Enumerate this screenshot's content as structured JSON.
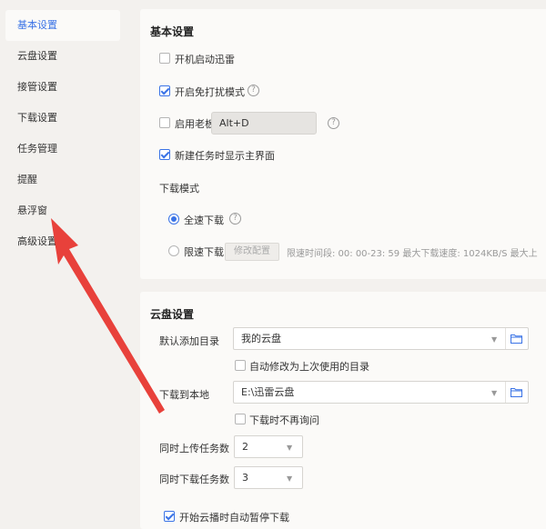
{
  "sidebar": {
    "items": [
      {
        "label": "基本设置"
      },
      {
        "label": "云盘设置"
      },
      {
        "label": "接管设置"
      },
      {
        "label": "下载设置"
      },
      {
        "label": "任务管理"
      },
      {
        "label": "提醒"
      },
      {
        "label": "悬浮窗"
      },
      {
        "label": "高级设置"
      }
    ]
  },
  "basic": {
    "title": "基本设置",
    "startup": "开机启动迅雷",
    "do_not_disturb": "开启免打扰模式",
    "boss_key": "启用老板键",
    "boss_key_value": "Alt+D",
    "show_main": "新建任务时显示主界面",
    "download_mode_label": "下载模式",
    "full_speed": "全速下载",
    "limited": "限速下载",
    "modify_config": "修改配置",
    "limit_info": "限速时间段:  00: 00-23: 59   最大下载速度: 1024KB/S   最大上"
  },
  "cloud": {
    "title": "云盘设置",
    "default_dir_label": "默认添加目录",
    "default_dir_value": "我的云盘",
    "auto_modify": "自动修改为上次使用的目录",
    "download_local_label": "下载到本地",
    "download_local_value": "E:\\迅雷云盘",
    "no_ask": "下载时不再询问",
    "upload_tasks_label": "同时上传任务数",
    "upload_tasks_value": "2",
    "download_tasks_label": "同时下载任务数",
    "download_tasks_value": "3",
    "pause_on_play": "开始云播时自动暂停下载"
  },
  "colors": {
    "accent": "#3a73e6",
    "annotation_arrow": "#e8413b"
  }
}
